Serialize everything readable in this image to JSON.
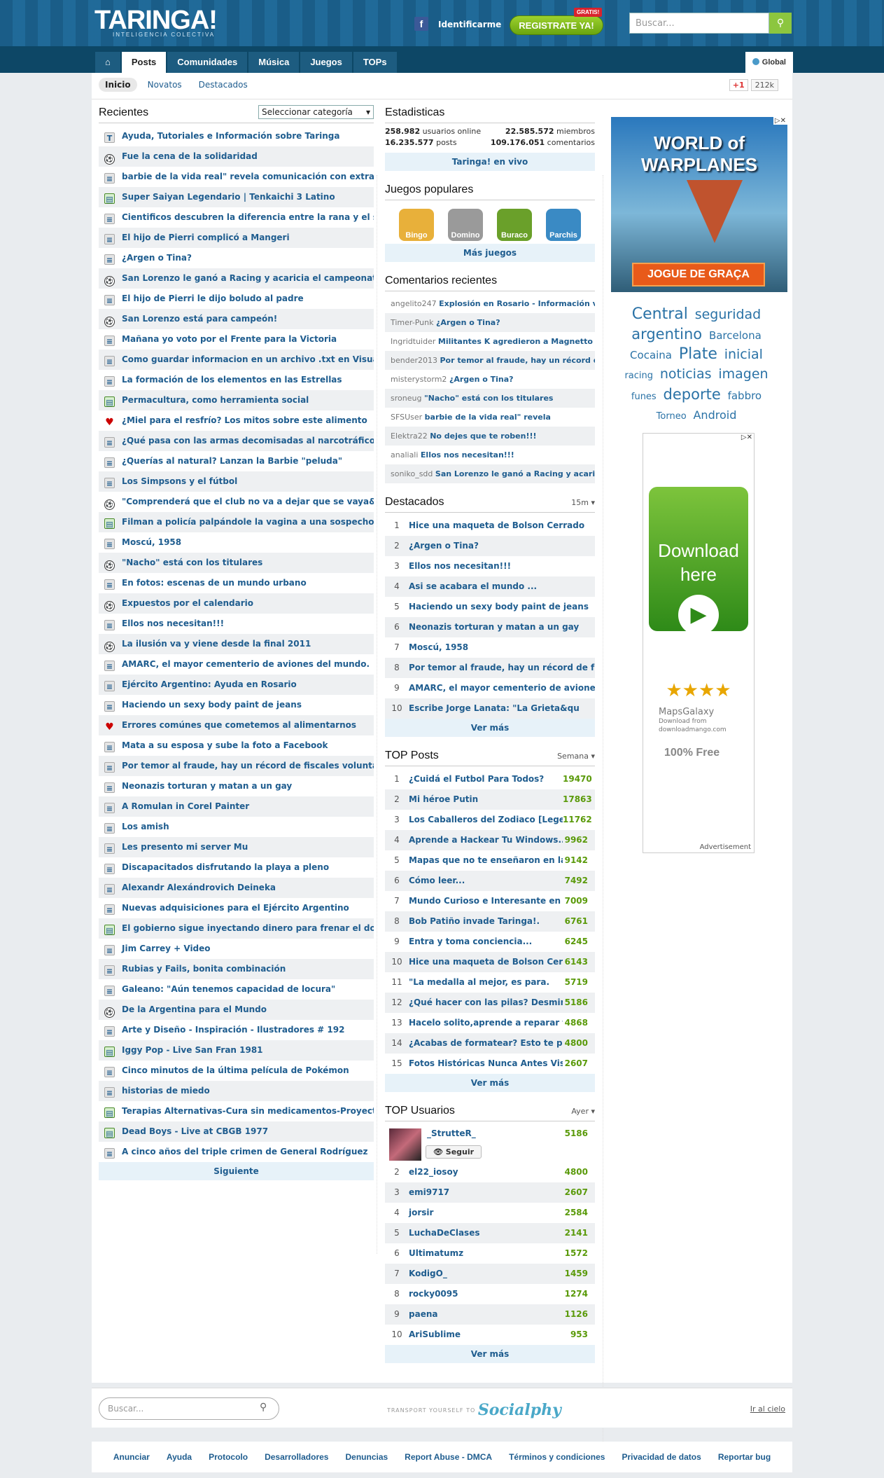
{
  "header": {
    "logo": "TARINGA!",
    "tagline": "INTELIGENCIA COLECTIVA",
    "login": "Identificarme",
    "register": "REGISTRATE YA!",
    "badge": "GRATIS!",
    "search_placeholder": "Buscar..."
  },
  "nav": {
    "tabs": [
      "Posts",
      "Comunidades",
      "Música",
      "Juegos",
      "TOPs"
    ],
    "scope": "Global"
  },
  "subnav": {
    "items": [
      "Inicio",
      "Novatos",
      "Destacados"
    ],
    "gplus": "+1",
    "gcount": "212k"
  },
  "recent": {
    "title": "Recientes",
    "category": "Seleccionar categoría",
    "more": "Siguiente",
    "items": [
      {
        "t": "Ayuda, Tutoriales e Información sobre Taringa",
        "i": "T"
      },
      {
        "t": "Fue la cena de la solidaridad",
        "i": "s"
      },
      {
        "t": "barbie de la vida real\" revela comunicación con extraterr",
        "i": "g"
      },
      {
        "t": "Super Saiyan Legendario | Tenkaichi 3 Latino",
        "i": "b"
      },
      {
        "t": "Cientificos descubren la diferencia entre la rana y el sapo",
        "i": "g"
      },
      {
        "t": "El hijo de Pierri complicó a Mangeri",
        "i": "g"
      },
      {
        "t": "¿Argen o Tina?",
        "i": "g"
      },
      {
        "t": "San Lorenzo le ganó a Racing y acaricia el campeonato",
        "i": "s"
      },
      {
        "t": "El hijo de Pierri le dijo boludo al padre",
        "i": "g"
      },
      {
        "t": "San Lorenzo está para campeón!",
        "i": "s"
      },
      {
        "t": "Mañana yo voto por el Frente para la Victoria",
        "i": "g"
      },
      {
        "t": "Como guardar informacion en un archivo .txt en Visual Basic",
        "i": "g"
      },
      {
        "t": "La formación de los elementos en las Estrellas",
        "i": "g"
      },
      {
        "t": "Permacultura, como herramienta social",
        "i": "b"
      },
      {
        "t": "¿Miel para el resfrío? Los mitos sobre este alimento",
        "i": "h"
      },
      {
        "t": "¿Qué pasa con las armas decomisadas al narcotráfico?",
        "i": "g"
      },
      {
        "t": "¿Querías al natural? Lanzan la Barbie \"peluda\"",
        "i": "g"
      },
      {
        "t": "Los Simpsons y el fútbol",
        "i": "g"
      },
      {
        "t": "\"Comprenderá que el club no va a dejar que se vaya&quo",
        "i": "s"
      },
      {
        "t": "Filman a policía palpándole la vagina a una sospechosa",
        "i": "b"
      },
      {
        "t": "Moscú, 1958",
        "i": "g"
      },
      {
        "t": "\"Nacho\" está con los titulares",
        "i": "s"
      },
      {
        "t": "En fotos: escenas de un mundo urbano",
        "i": "g"
      },
      {
        "t": "Expuestos por el calendario",
        "i": "s"
      },
      {
        "t": "Ellos nos necesitan!!!",
        "i": "g"
      },
      {
        "t": "La ilusión va y viene desde la final 2011",
        "i": "s"
      },
      {
        "t": "AMARC, el mayor cementerio de aviones del mundo.",
        "i": "g"
      },
      {
        "t": "Ejército Argentino: Ayuda en Rosario",
        "i": "g"
      },
      {
        "t": "Haciendo un sexy body paint de jeans",
        "i": "g"
      },
      {
        "t": "Errores comúnes que cometemos al alimentarnos",
        "i": "h"
      },
      {
        "t": "Mata a su esposa y sube la foto a Facebook",
        "i": "g"
      },
      {
        "t": "Por temor al fraude, hay un récord de fiscales voluntarios",
        "i": "g"
      },
      {
        "t": "Neonazis torturan y matan a un gay",
        "i": "g"
      },
      {
        "t": "A Romulan in Corel Painter",
        "i": "g"
      },
      {
        "t": "Los amish",
        "i": "g"
      },
      {
        "t": "Les presento mi server Mu",
        "i": "g"
      },
      {
        "t": "Discapacitados disfrutando la playa a pleno",
        "i": "g"
      },
      {
        "t": "Alexandr Alexándrovich Deineka",
        "i": "g"
      },
      {
        "t": "Nuevas adquisiciones para el Ejército Argentino",
        "i": "g"
      },
      {
        "t": "El gobierno sigue inyectando dinero para frenar el dolar blu",
        "i": "b"
      },
      {
        "t": "Jim Carrey + Video",
        "i": "g"
      },
      {
        "t": "Rubias y Fails, bonita combinación",
        "i": "g"
      },
      {
        "t": "Galeano: \"Aún tenemos capacidad de locura\"",
        "i": "g"
      },
      {
        "t": "De la Argentina para el Mundo",
        "i": "s"
      },
      {
        "t": "Arte y Diseño - Inspiración - Ilustradores # 192",
        "i": "g"
      },
      {
        "t": "Iggy Pop - Live San Fran 1981",
        "i": "b"
      },
      {
        "t": "Cinco minutos de la última película de Pokémon",
        "i": "g"
      },
      {
        "t": "historias de miedo",
        "i": "g"
      },
      {
        "t": "Terapias Alternativas-Cura sin medicamentos-Proyecto G",
        "i": "b"
      },
      {
        "t": "Dead Boys - Live at CBGB 1977",
        "i": "b"
      },
      {
        "t": "A cinco años del triple crimen de General Rodríguez",
        "i": "g"
      }
    ]
  },
  "stats": {
    "title": "Estadisticas",
    "online": "258.982",
    "online_l": "usuarios online",
    "members": "22.585.572",
    "members_l": "miembros",
    "posts": "16.235.577",
    "posts_l": "posts",
    "comments": "109.176.051",
    "comments_l": "comentarios",
    "live": "Taringa! en vivo"
  },
  "games": {
    "title": "Juegos populares",
    "items": [
      "Bingo",
      "Domino",
      "Buraco",
      "Parchis"
    ],
    "more": "Más juegos"
  },
  "comments": {
    "title": "Comentarios recientes",
    "items": [
      {
        "u": "angelito247",
        "t": "Explosión en Rosario - Información varia"
      },
      {
        "u": "Timer-Punk",
        "t": "¿Argen o Tina?"
      },
      {
        "u": "Ingridtuider",
        "t": "Militantes K agredieron a Magnetto"
      },
      {
        "u": "bender2013",
        "t": "Por temor al fraude, hay un récord de"
      },
      {
        "u": "misterystorm2",
        "t": "¿Argen o Tina?"
      },
      {
        "u": "sroneug",
        "t": "\"Nacho\" está con los titulares"
      },
      {
        "u": "SFSUser",
        "t": "barbie de la vida real\" revela"
      },
      {
        "u": "Elektra22",
        "t": "No dejes que te roben!!!"
      },
      {
        "u": "analiali",
        "t": "Ellos nos necesitan!!!"
      },
      {
        "u": "soniko_sdd",
        "t": "San Lorenzo le ganó a Racing y acaricia"
      }
    ]
  },
  "destacados": {
    "title": "Destacados",
    "opt": "15m ▾",
    "more": "Ver más",
    "items": [
      "Hice una maqueta de Bolson Cerrado",
      "¿Argen o Tina?",
      "Ellos nos necesitan!!!",
      "Asi se acabara el mundo ...",
      "Haciendo un sexy body paint de jeans",
      "Neonazis torturan y matan a un gay",
      "Moscú, 1958",
      "Por temor al fraude, hay un récord de f",
      "AMARC, el mayor cementerio de aviones de",
      "Escribe Jorge Lanata: \"La Grieta&qu"
    ]
  },
  "top_posts": {
    "title": "TOP Posts",
    "opt": "Semana ▾",
    "more": "Ver más",
    "items": [
      {
        "t": "¿Cuidá el Futbol Para Todos?",
        "v": "19470"
      },
      {
        "t": "Mi héroe Putin",
        "v": "17863"
      },
      {
        "t": "Los Caballeros del Zodiaco [Legenda",
        "v": "11762"
      },
      {
        "t": "Aprende a Hackear Tu Windows..\"",
        "v": "9962"
      },
      {
        "t": "Mapas que no te enseñaron en la es",
        "v": "9142"
      },
      {
        "t": "Cómo leer...",
        "v": "7492"
      },
      {
        "t": "Mundo Curioso e Interesante en Gif",
        "v": "7009"
      },
      {
        "t": "Bob Patiño invade Taringa!.",
        "v": "6761"
      },
      {
        "t": "Entra y toma conciencia...",
        "v": "6245"
      },
      {
        "t": "Hice una maqueta de Bolson Cerrado",
        "v": "6143"
      },
      {
        "t": "\"La medalla al mejor, es para.",
        "v": "5719"
      },
      {
        "t": "¿Qué hacer con las pilas? Desmint",
        "v": "5186"
      },
      {
        "t": "Hacelo solito,aprende a reparar tu",
        "v": "4868"
      },
      {
        "t": "¿Acabas de formatear? Esto te pued",
        "v": "4800"
      },
      {
        "t": "Fotos Históricas Nunca Antes Visto",
        "v": "2607"
      }
    ]
  },
  "top_users": {
    "title": "TOP Usuarios",
    "opt": "Ayer ▾",
    "more": "Ver más",
    "first": {
      "name": "_StrutteR_",
      "v": "5186",
      "follow": "Seguir"
    },
    "items": [
      {
        "t": "el22_iosoy",
        "v": "4800"
      },
      {
        "t": "emi9717",
        "v": "2607"
      },
      {
        "t": "jorsir",
        "v": "2584"
      },
      {
        "t": "LuchaDeClases",
        "v": "2141"
      },
      {
        "t": "Ultimatumz",
        "v": "1572"
      },
      {
        "t": "KodigO_",
        "v": "1459"
      },
      {
        "t": "rocky0095",
        "v": "1274"
      },
      {
        "t": "paena",
        "v": "1126"
      },
      {
        "t": "AriSublime",
        "v": "953"
      }
    ]
  },
  "ad1": {
    "title": "WORLD of WARPLANES",
    "cta": "JOGUE DE GRAÇA"
  },
  "tags": [
    "Central",
    "seguridad",
    "argentino",
    "Barcelona",
    "Cocaina",
    "Plate",
    "inicial",
    "racing",
    "noticias",
    "imagen",
    "funes",
    "deporte",
    "fabbro",
    "Torneo",
    "Android"
  ],
  "ad2": {
    "line1": "Download",
    "line2": "here",
    "brand": "MapsGalaxy",
    "sub1": "Download from",
    "sub2": "downloadmango.com",
    "free": "100% Free",
    "label": "Advertisement"
  },
  "footer": {
    "search": "Buscar...",
    "transport": "TRANSPORT YOURSELF TO",
    "brand": "Socialphy",
    "top": "Ir al cielo",
    "links": [
      "Anunciar",
      "Ayuda",
      "Protocolo",
      "Desarrolladores",
      "Denuncias",
      "Report Abuse - DMCA",
      "Términos y condiciones",
      "Privacidad de datos",
      "Reportar bug"
    ]
  }
}
